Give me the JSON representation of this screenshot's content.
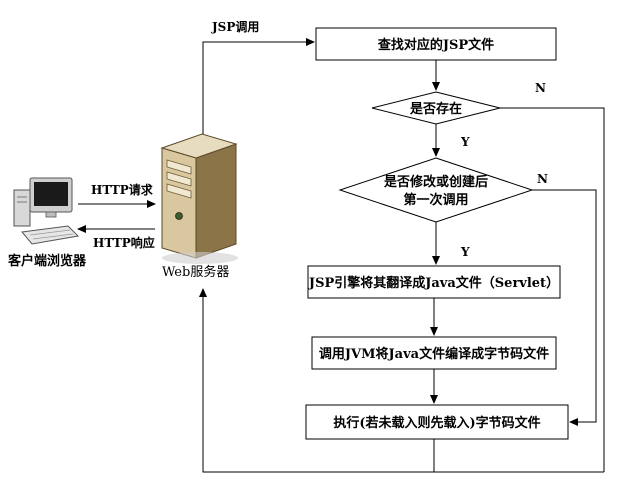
{
  "labels": {
    "jsp_call": "JSP调用",
    "http_request": "HTTP请求",
    "http_response": "HTTP响应",
    "client": "客户端浏览器",
    "server": "Web服务器",
    "n1": "N",
    "n2": "N",
    "y1": "Y",
    "y2": "Y"
  },
  "steps": {
    "find": "查找对应的JSP文件",
    "exists": "是否存在",
    "modified_line1": "是否修改或创建后",
    "modified_line2": "第一次调用",
    "translate": "JSP引擎将其翻译成Java文件（Servlet）",
    "compile": "调用JVM将Java文件编译成字节码文件",
    "execute": "执行(若未载入则先载入)字节码文件"
  },
  "colors": {
    "stroke": "#000000",
    "fill": "#ffffff",
    "server_body": "#d9c7a0",
    "server_dark": "#8a7448",
    "computer_body": "#cfcfcf",
    "computer_screen": "#1a1a1a"
  },
  "icons": {
    "client": "desktop-computer-icon",
    "server": "server-tower-icon"
  }
}
